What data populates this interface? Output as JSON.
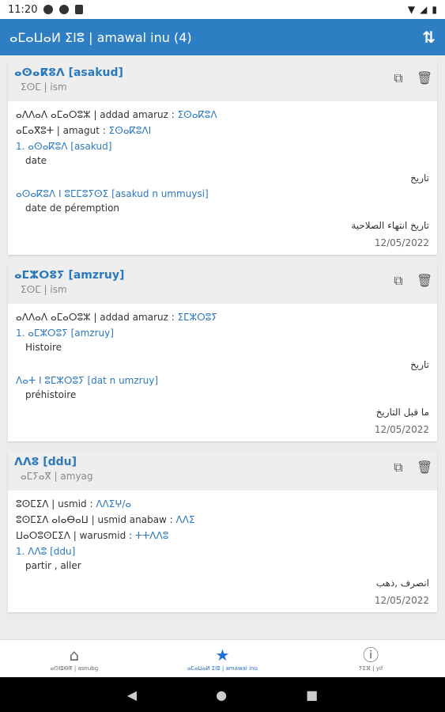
{
  "statusbar": {
    "time": "11:20"
  },
  "appbar": {
    "title": "ⴰⵎⴰⵡⴰⵍ ⵉⵏⵓ | amawal inu  (4)"
  },
  "cards": [
    {
      "title": "ⴰⵙⴰⴽⵓⴷ [asakud]",
      "subtitle": "ⵉⵙⵎ | ism",
      "rows": [
        {
          "label": "ⴰⴷⴷⴰⴷ ⴰⵎⴰⵔⵓⵣ | addad amaruz : ",
          "link": "ⵉⵙⴰⴽⵓⴷ"
        },
        {
          "label": "ⴰⵎⴰⴳⵓⵜ | amagut : ",
          "link": "ⵉⵙⴰⴽⵓⴷⵏ"
        }
      ],
      "senses": [
        {
          "head": "1. ⴰⵙⴰⴽⵓⴷ [asakud]",
          "fr": "date",
          "ar": "تاريخ"
        },
        {
          "head": "ⴰⵙⴰⴽⵓⴷ ⵏ ⵓⵎⵎⵓⵢⵙⵉ [asakud n ummuysi]",
          "fr": "date de péremption",
          "ar": "تاريخ انتهاء الصلاحية"
        }
      ],
      "date": "12/05/2022"
    },
    {
      "title": "ⴰⵎⵣⵔⵓⵢ [amzruy]",
      "subtitle": "ⵉⵙⵎ | ism",
      "rows": [
        {
          "label": "ⴰⴷⴷⴰⴷ ⴰⵎⴰⵔⵓⵣ | addad amaruz : ",
          "link": "ⵉⵎⵣⵔⵓⵢ"
        }
      ],
      "senses": [
        {
          "head": "1. ⴰⵎⵣⵔⵓⵢ [amzruy]",
          "fr": "Histoire",
          "ar": "تاريخ"
        },
        {
          "head": "ⴷⴰⵜ ⵏ ⵓⵎⵣⵔⵓⵢ [dat n umzruy]",
          "fr": "préhistoire",
          "ar": "ما قبل التاريخ"
        }
      ],
      "date": "12/05/2022"
    },
    {
      "title": "ⴷⴷⵓ [ddu]",
      "subtitle": "ⴰⵎⵢⴰⴳ | amyag",
      "rows": [
        {
          "label": "ⵓⵙⵎⵉⴷ | usmid : ",
          "link": "ⴷⴷⵉⵖ/ⴰ"
        },
        {
          "label": "ⵓⵙⵎⵉⴷ ⴰⵏⴰⴱⴰⵡ | usmid anabaw : ",
          "link": "ⴷⴷⵉ"
        },
        {
          "label": "ⵡⴰⵔⵓⵙⵎⵉⴷ | warusmid : ",
          "link": "ⵜⵜⴷⴷⵓ"
        }
      ],
      "senses": [
        {
          "head": "1. ⴷⴷⵓ [ddu]",
          "fr": "partir , aller",
          "ar": "انصرف ,ذهب"
        }
      ],
      "date": "12/05/2022"
    }
  ],
  "bottomnav": [
    {
      "icon": "⌂",
      "label": "ⴰⵙⵏⵓⴱⴳ | asnubg"
    },
    {
      "icon": "★",
      "label": "ⴰⵎⴰⵡⴰⵍ ⵉⵏⵓ | amawal inu"
    },
    {
      "icon": "ⓘ",
      "label": "ⵢⵉⴼ | yif"
    }
  ],
  "sysnav": {
    "back": "◀",
    "home": "●",
    "recents": "■"
  }
}
